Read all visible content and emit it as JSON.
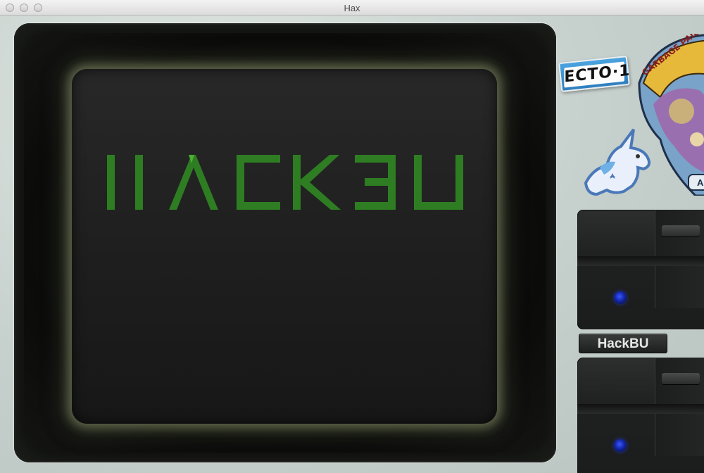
{
  "window": {
    "title": "Hax"
  },
  "screen": {
    "logo_text": "HACKBU",
    "logo_color": "#2e7d23"
  },
  "stickers": {
    "ecto_label": "ECTO·1",
    "gpk_label": "GARBAGE PAIL K",
    "gpk_corner": "A"
  },
  "nameplate": {
    "label": "HackBU"
  },
  "drives": [
    {
      "led_color": "#2238d8"
    },
    {
      "led_color": "#2238d8"
    }
  ]
}
